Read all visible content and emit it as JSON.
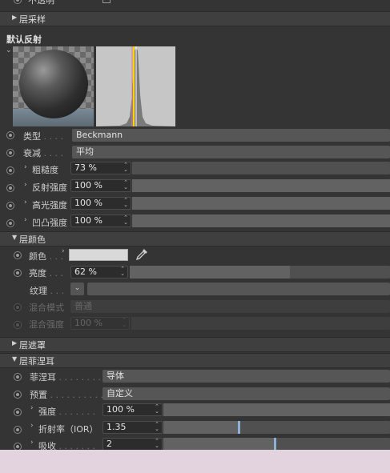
{
  "top_cut_label": "不透明",
  "sections": {
    "layer_sampling": "层采样",
    "default_reflection": "默认反射",
    "layer_color": "层颜色",
    "layer_mask": "层遮罩",
    "layer_fresnel": "层菲涅耳"
  },
  "reflection": {
    "type_label": "类型",
    "type_value": "Beckmann",
    "attenuation_label": "衰减",
    "attenuation_value": "平均",
    "roughness_label": "粗糙度",
    "roughness_value": "73 %",
    "roughness_level": 0,
    "reflect_strength_label": "反射强度",
    "reflect_strength_value": "100 %",
    "specular_strength_label": "高光强度",
    "specular_strength_value": "100 %",
    "bump_strength_label": "凹凸强度",
    "bump_strength_value": "100 %"
  },
  "color": {
    "color_label": "颜色",
    "color_swatch": "#d9d9d9",
    "brightness_label": "亮度",
    "brightness_value": "62 %",
    "texture_label": "纹理",
    "blend_mode_label": "混合模式",
    "blend_mode_value": "普通",
    "blend_strength_label": "混合强度",
    "blend_strength_value": "100 %"
  },
  "fresnel": {
    "fresnel_label": "菲涅耳",
    "fresnel_value": "导体",
    "preset_label": "预置",
    "preset_value": "自定义",
    "strength_label": "强度",
    "strength_value": "100 %",
    "ior_label": "折射率（IOR）",
    "ior_value": "1.35",
    "ior_slider_fraction": 0.35,
    "absorb_label": "吸收",
    "absorb_value": "2",
    "absorb_slider_fraction": 0.5
  },
  "colors": {
    "panel_bg": "#343434",
    "accent_knob": "#8fb0d6",
    "highlight_line": "#ffd700"
  }
}
